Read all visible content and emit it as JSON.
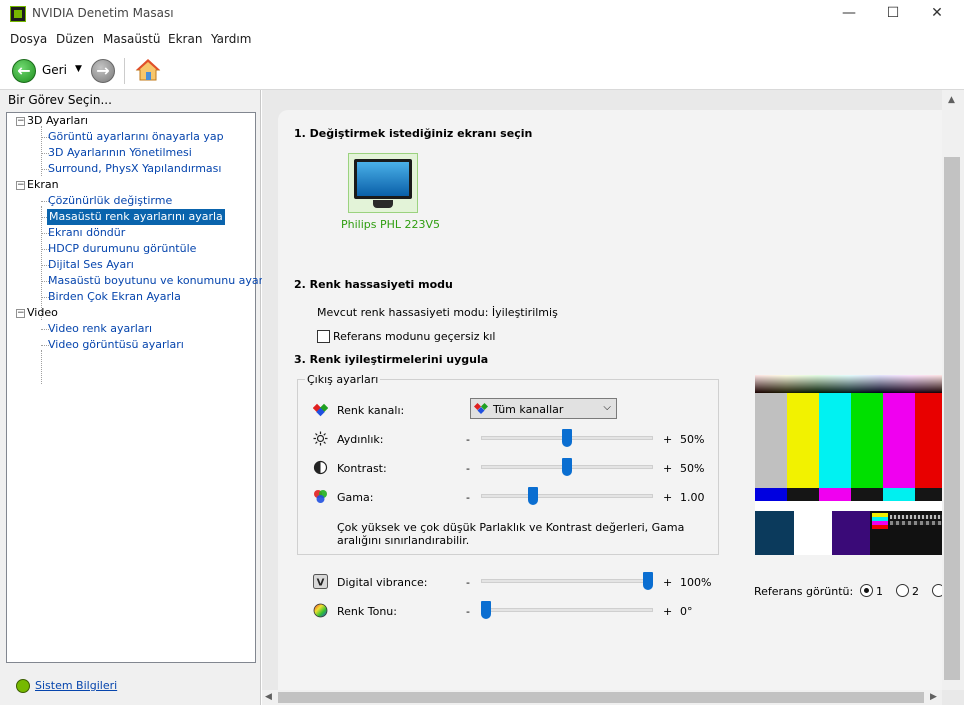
{
  "window": {
    "title": "NVIDIA Denetim Masası"
  },
  "menu": [
    "Dosya",
    "Düzen",
    "Masaüstü",
    "Ekran",
    "Yardım"
  ],
  "toolbar": {
    "back_label": "Geri"
  },
  "task_pane": {
    "label": "Bir Görev Seçin...",
    "groups": [
      {
        "label": "3D Ayarları",
        "items": [
          "Görüntü ayarlarını önayarla yap",
          "3D Ayarlarının Yönetilmesi",
          "Surround, PhysX Yapılandırması"
        ]
      },
      {
        "label": "Ekran",
        "items": [
          "Çözünürlük değiştirme",
          "Masaüstü renk ayarlarını ayarla",
          "Ekranı döndür",
          "HDCP durumunu görüntüle",
          "Dijital Ses Ayarı",
          "Masaüstü boyutunu ve konumunu ayarla",
          "Birden Çok Ekran Ayarla"
        ]
      },
      {
        "label": "Video",
        "items": [
          "Video renk ayarları",
          "Video görüntüsü ayarları"
        ]
      }
    ],
    "selected": "Masaüstü renk ayarlarını ayarla",
    "system_info": "Sistem Bilgileri"
  },
  "section1": {
    "title": "1. Değiştirmek istediğiniz ekranı seçin",
    "display_name": "Philips PHL 223V5"
  },
  "section2": {
    "title": "2. Renk hassasiyeti modu",
    "current_mode": "Mevcut renk hassasiyeti modu: İyileştirilmiş",
    "reference_checkbox": "Referans modunu geçersiz kıl",
    "reference_checked": false
  },
  "section3": {
    "title": "3. Renk iyileştirmelerini uygula",
    "group_label": "Çıkış ayarları",
    "channel": {
      "label": "Renk kanalı:",
      "value": "Tüm kanallar"
    },
    "brightness": {
      "label": "Aydınlık:",
      "minus": "-",
      "plus": "+",
      "value_text": "50%",
      "level": 0.5
    },
    "contrast": {
      "label": "Kontrast:",
      "minus": "-",
      "plus": "+",
      "value_text": "50%",
      "level": 0.5
    },
    "gamma": {
      "label": "Gama:",
      "minus": "-",
      "plus": "+",
      "value_text": "1.00",
      "level": 0.29
    },
    "warning": [
      "Çok yüksek ve çok düşük Parlaklık ve Kontrast değerleri, Gama",
      "aralığını sınırlandırabilir."
    ],
    "vibrance": {
      "label": "Digital vibrance:",
      "minus": "-",
      "plus": "+",
      "value_text": "100%",
      "level": 1.0
    },
    "hue": {
      "label": "Renk Tonu:",
      "minus": "-",
      "plus": "+",
      "value_text": "0°",
      "level": 0.0
    }
  },
  "reference_image": {
    "label": "Referans görüntü:",
    "options": [
      "1",
      "2"
    ],
    "selected": "1"
  },
  "colors": {
    "nvidia_green": "#76b900",
    "selection_blue": "#0a64ad",
    "link_blue": "#0645ad",
    "slider_blue": "#0a6ed1"
  }
}
